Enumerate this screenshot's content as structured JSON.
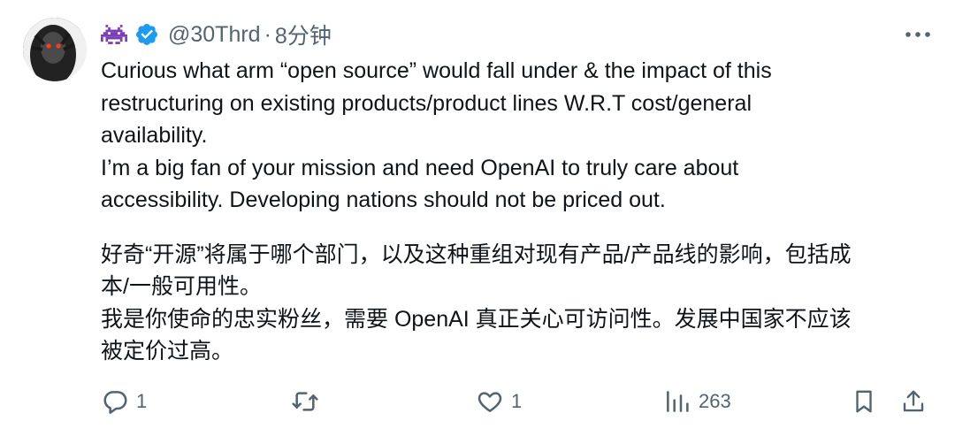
{
  "tweet": {
    "handle": "@30Thrd",
    "separator": "·",
    "time": "8分钟",
    "lines_en": [
      "Curious what arm “open source” would fall under & the impact of this",
      "restructuring on existing products/product lines W.R.T cost/general",
      "availability.",
      "I’m a big fan of your mission and need OpenAI to truly care about",
      "accessibility. Developing nations should not be priced out."
    ],
    "lines_zh": [
      "好奇“开源”将属于哪个部门，以及这种重组对现有产品/产品线的影响，包括成",
      "本/一般可用性。",
      "我是你使命的忠实粉丝，需要 OpenAI 真正关心可访问性。发展中国家不应该",
      "被定价过高。"
    ]
  },
  "actions": {
    "reply_count": "1",
    "retweet_count": "",
    "like_count": "1",
    "views_count": "263"
  },
  "colors": {
    "text": "#0f1419",
    "muted": "#536471",
    "verified": "#1d9bf0",
    "emoji": "#7a3fb5"
  }
}
